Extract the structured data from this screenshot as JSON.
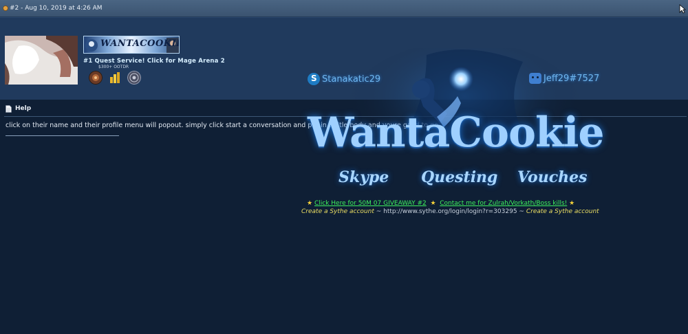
{
  "post": {
    "number_date": "#2 - Aug 10, 2019 at 4:26 AM"
  },
  "user": {
    "username": "WANTACOOKIE",
    "title": "#1 Quest Service! Click for Mage Arena 2",
    "subtitle": "$300+ OOTDR",
    "badges": [
      "trade-badge",
      "gold-stack-badge",
      "seal-badge"
    ]
  },
  "message": {
    "title": "Help",
    "text": "click on their name and their profile menu will popout. simply click start a conversation and put in a title/body and youre good to go"
  },
  "signature": {
    "skype": "Stanakatic29",
    "discord": "Jeff29#7527",
    "wordmark": "WantaCookie",
    "tags": [
      "Skype",
      "Questing",
      "Vouches"
    ],
    "giveaway_link": "Click Here for 50M 07 GIVEAWAY #2",
    "contact_link": "Contact me for Zulrah/Vorkath/Boss kills!",
    "sythe_prefix": "Create a Sythe account",
    "sythe_url": "http://www.sythe.org/login/login?r=303295",
    "sythe_suffix": "Create a Sythe account"
  },
  "colors": {
    "background": "#0f1f35",
    "header": "#3a5370",
    "userinfo": "#203a5d",
    "link_green": "#3df15d",
    "accent_yellow": "#ecdf63"
  }
}
